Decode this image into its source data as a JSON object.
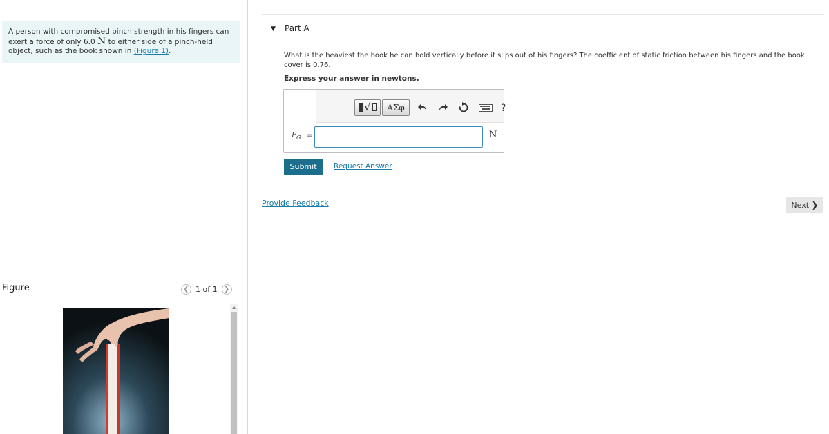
{
  "intro": {
    "text_before": "A person with compromised pinch strength in his fingers can exert a force of only 6.0 ",
    "unit_symbol": "N",
    "text_after": " to either side of a pinch-held object, such as the book shown in ",
    "figure_link": "(Figure 1)",
    "text_end": "."
  },
  "figure": {
    "title": "Figure",
    "pager": {
      "prev_icon": "chevron-left-icon",
      "next_icon": "chevron-right-icon",
      "text": "1 of 1"
    }
  },
  "part": {
    "toggle_icon": "triangle-down-icon",
    "label": "Part A"
  },
  "question": {
    "text": "What is the heaviest the book he can hold vertically before it slips out of his fingers? The coefficient of static friction between his fingers and the book cover is 0.76.",
    "express": "Express your answer in newtons."
  },
  "toolbar": {
    "templates_icon": "templates-icon",
    "greek_label": "ΑΣφ",
    "undo_icon": "undo-icon",
    "redo_icon": "redo-icon",
    "reset_icon": "reset-icon",
    "keyboard_icon": "keyboard-icon",
    "help_label": "?"
  },
  "answer": {
    "var": "F",
    "var_sub": "G",
    "equals": "=",
    "value": "",
    "unit": "N"
  },
  "buttons": {
    "submit": "Submit",
    "request": "Request Answer",
    "feedback": "Provide Feedback",
    "next": "Next"
  },
  "colors": {
    "intro_bg": "#e9f5f6",
    "link": "#1a7dab",
    "submit_bg": "#1b6f8d",
    "input_border": "#3a8bbf",
    "next_bg": "#e6e6e6"
  }
}
